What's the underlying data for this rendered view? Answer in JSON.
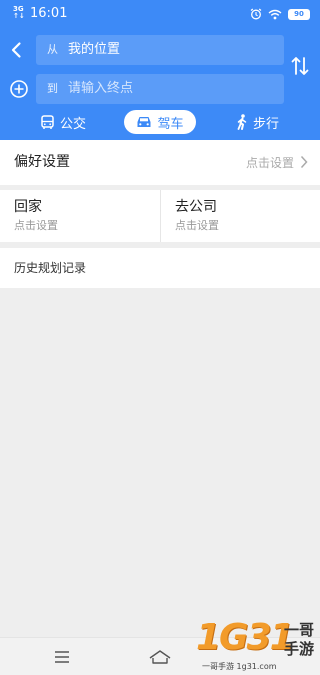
{
  "status_bar": {
    "network_top": "3G",
    "network_bottom": "↑↓",
    "time": "16:01",
    "battery": "90"
  },
  "route": {
    "from_prefix": "从",
    "from_value": "我的位置",
    "to_prefix": "到",
    "to_placeholder": "请输入终点"
  },
  "modes": {
    "bus": "公交",
    "car": "驾车",
    "walk": "步行",
    "selected": "car"
  },
  "preferences": {
    "title": "偏好设置",
    "hint": "点击设置"
  },
  "shortcuts": {
    "home_title": "回家",
    "home_sub": "点击设置",
    "work_title": "去公司",
    "work_sub": "点击设置"
  },
  "history": {
    "title": "历史规划记录"
  },
  "watermark": {
    "big": "1G31",
    "side_top": "一哥",
    "side_bottom": "手游",
    "caption": "一哥手游 1g31.com"
  },
  "colors": {
    "accent": "#3d8af7",
    "field": "#5b9cf8",
    "background": "#eeeeee"
  },
  "icons": {
    "back": "chevron-left-icon",
    "add": "add-circle-icon",
    "swap": "swap-vertical-icon",
    "bus": "bus-icon",
    "car": "car-icon",
    "walk": "walk-icon",
    "alarm": "alarm-icon",
    "wifi": "wifi-icon",
    "menu": "menu-icon",
    "home": "home-icon"
  }
}
